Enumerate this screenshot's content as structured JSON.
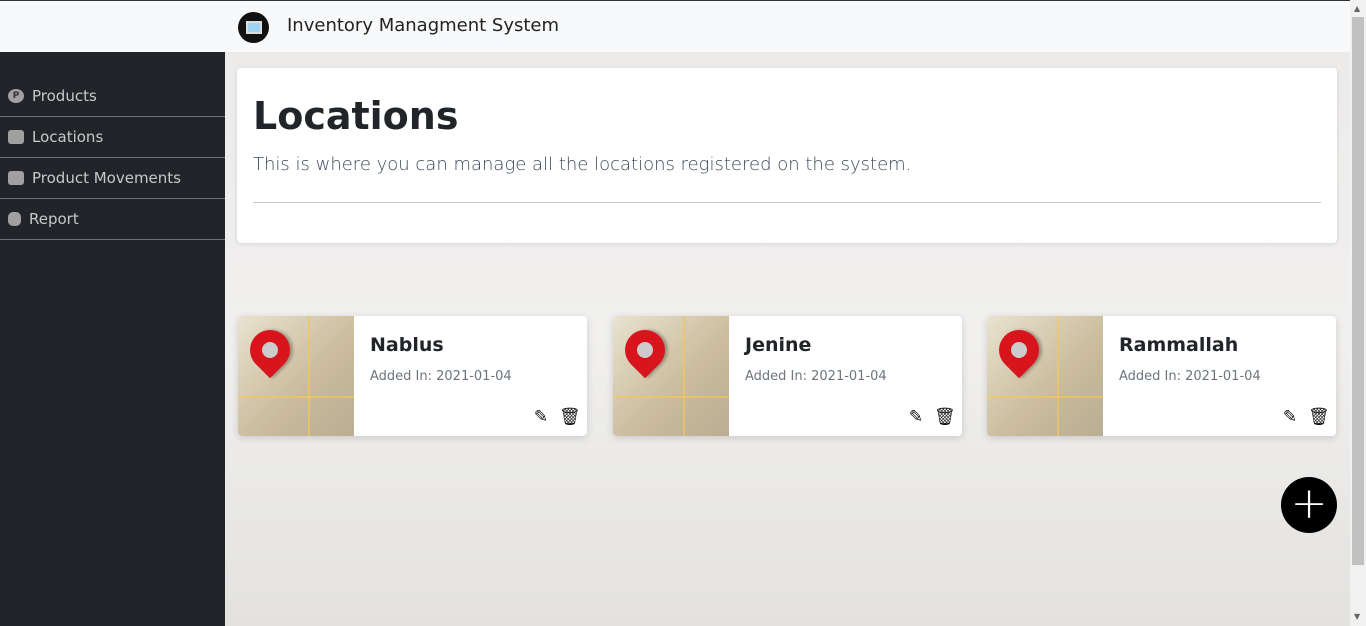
{
  "app": {
    "title": "Inventory Managment System",
    "logo_icon": "monitor-chart-icon"
  },
  "sidebar": {
    "items": [
      {
        "label": "Products",
        "icon": "product-p-icon"
      },
      {
        "label": "Locations",
        "icon": "map-icon"
      },
      {
        "label": "Product Movements",
        "icon": "boxes-icon"
      },
      {
        "label": "Report",
        "icon": "database-icon"
      }
    ]
  },
  "header": {
    "title": "Locations",
    "subtitle": "This is where you can manage all the locations registered on the system."
  },
  "locations": [
    {
      "name": "Nablus",
      "added": "Added In: 2021-01-04"
    },
    {
      "name": "Jenine",
      "added": "Added In: 2021-01-04"
    },
    {
      "name": "Rammallah",
      "added": "Added In: 2021-01-04"
    }
  ],
  "add_button": {
    "label": "+"
  },
  "colors": {
    "sidebar": "#212529",
    "pin": "#d8141c",
    "fab": "#000000"
  }
}
